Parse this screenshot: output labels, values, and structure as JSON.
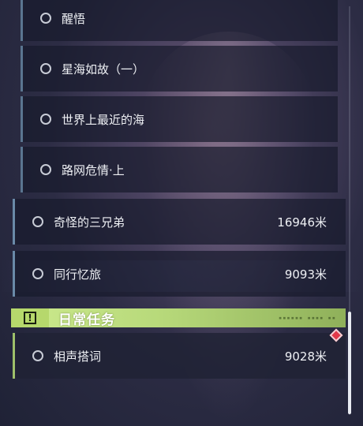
{
  "quests": {
    "story_sub": [
      {
        "label": "醒悟"
      },
      {
        "label": "星海如故（一）"
      },
      {
        "label": "世界上最近的海"
      },
      {
        "label": "路网危情·上"
      }
    ],
    "story_main": [
      {
        "label": "奇怪的三兄弟",
        "distance": "16946米"
      },
      {
        "label": "同行忆旅",
        "distance": "9093米"
      }
    ],
    "daily_section": {
      "title": "日常任务",
      "icon": "alert-icon"
    },
    "daily": [
      {
        "label": "相声搭词",
        "distance": "9028米"
      }
    ]
  },
  "colors": {
    "daily_accent": "#b7d97a",
    "track_marker": "#e23a4a"
  }
}
